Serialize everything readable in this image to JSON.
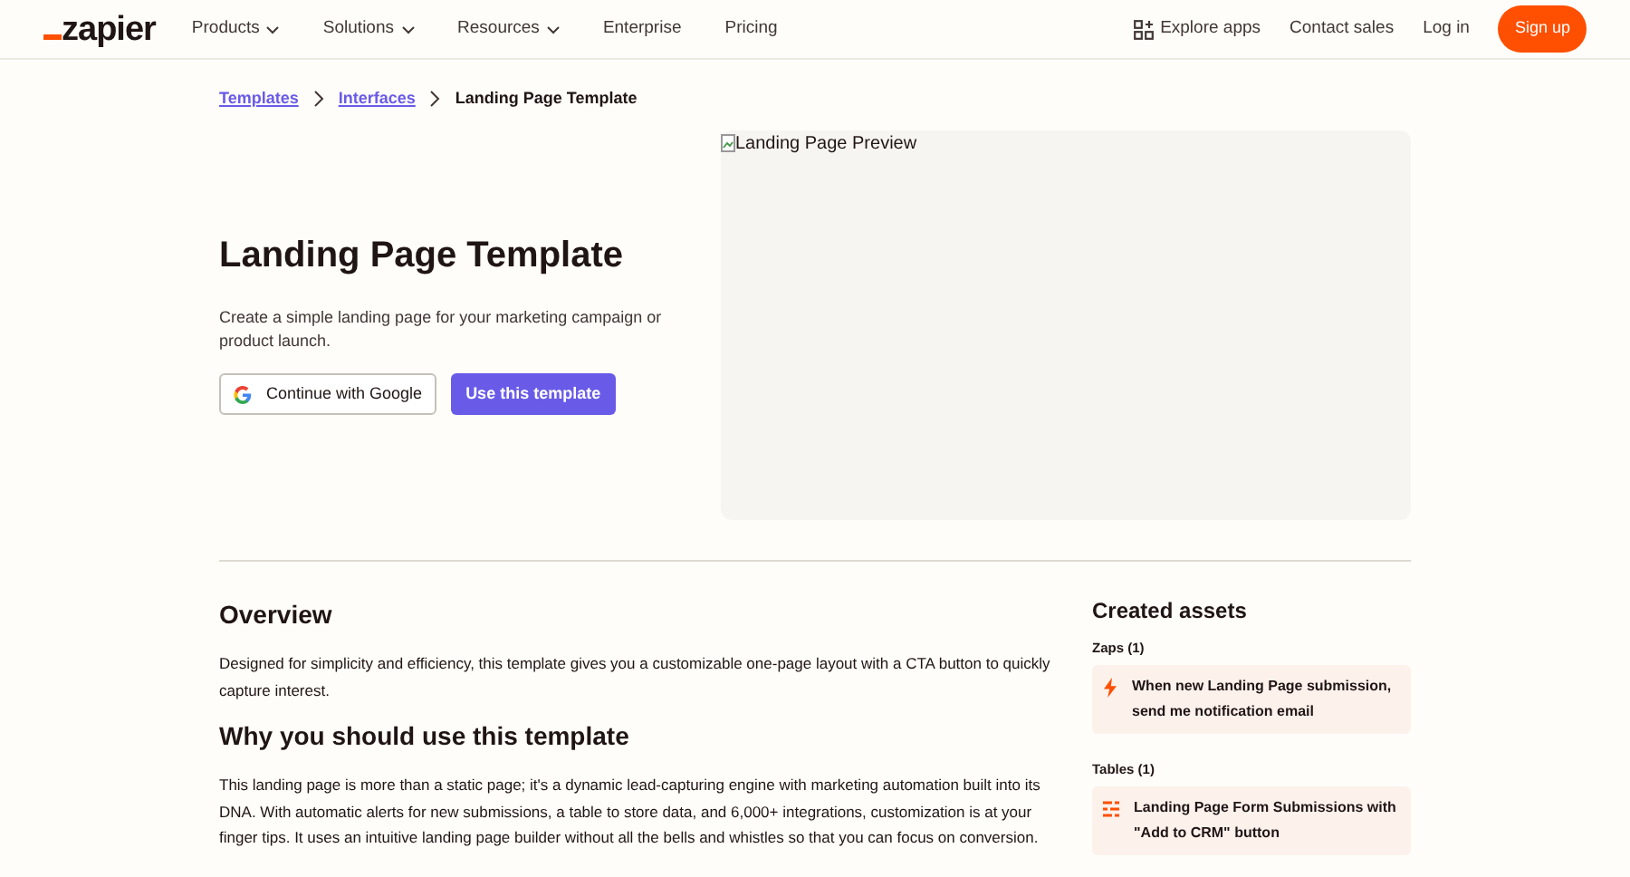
{
  "header": {
    "logo": "zapier",
    "nav": [
      {
        "label": "Products",
        "dropdown": true
      },
      {
        "label": "Solutions",
        "dropdown": true
      },
      {
        "label": "Resources",
        "dropdown": true
      },
      {
        "label": "Enterprise",
        "dropdown": false
      },
      {
        "label": "Pricing",
        "dropdown": false
      }
    ],
    "right": [
      {
        "label": "Explore apps",
        "kind": "icon-link"
      },
      {
        "label": "Contact sales",
        "kind": "link"
      },
      {
        "label": "Log in",
        "kind": "link"
      },
      {
        "label": "Sign up",
        "kind": "button"
      }
    ]
  },
  "breadcrumb": [
    {
      "label": "Templates",
      "link": true
    },
    {
      "label": "Interfaces",
      "link": true
    },
    {
      "label": "Landing Page Template",
      "link": false
    }
  ],
  "hero": {
    "title": "Landing Page Template",
    "description": "Create a simple landing page for your marketing campaign or product launch.",
    "buttons": [
      {
        "label": "Continue with Google",
        "kind": "google"
      },
      {
        "label": "Use this template",
        "kind": "primary"
      }
    ],
    "preview_alt": "Landing Page Preview"
  },
  "overview": {
    "sections": [
      {
        "heading": "Overview",
        "text": "Designed for simplicity and efficiency, this template gives you a customizable one-page layout with a CTA button to quickly capture interest."
      },
      {
        "heading": "Why you should use this template",
        "text": "This landing page is more than a static page; it's a dynamic lead-capturing engine with marketing automation built into its DNA. With automatic alerts for new submissions, a table to store data, and 6,000+ integrations, customization is at your finger tips. It uses an intuitive landing page builder without all the bells and whistles so that you can focus on conversion."
      }
    ]
  },
  "assets": {
    "title": "Created assets",
    "groups": [
      {
        "label": "Zaps (1)",
        "kind": "zap",
        "items": [
          "When new Landing Page submission, send me notification email"
        ]
      },
      {
        "label": "Tables (1)",
        "kind": "table",
        "items": [
          "Landing Page Form Submissions with \"Add to CRM\" button"
        ]
      }
    ]
  }
}
